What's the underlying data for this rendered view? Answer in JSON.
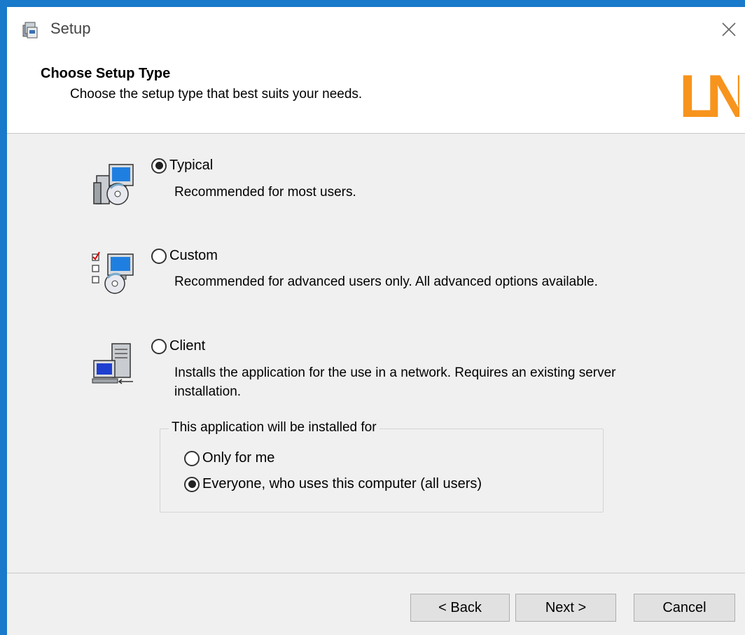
{
  "window": {
    "title": "Setup",
    "close_icon": "close-icon",
    "app_icon": "setup-app-icon"
  },
  "header": {
    "title": "Choose Setup Type",
    "subtitle": "Choose the setup type that best suits your needs.",
    "logo_text": "LN",
    "logo_color": "#f7941d"
  },
  "options": [
    {
      "label": "Typical",
      "description": "Recommended for most users.",
      "selected": true,
      "icon": "typical-setup-icon"
    },
    {
      "label": "Custom",
      "description": "Recommended for advanced users only. All advanced options available.",
      "selected": false,
      "icon": "custom-setup-icon"
    },
    {
      "label": "Client",
      "description": "Installs the application for the use in a network. Requires an existing server installation.",
      "selected": false,
      "icon": "client-setup-icon"
    }
  ],
  "install_for": {
    "legend": "This application will be installed for",
    "options": [
      {
        "label": "Only for me",
        "selected": false
      },
      {
        "label": "Everyone, who uses this computer (all users)",
        "selected": true
      }
    ]
  },
  "buttons": {
    "back": "< Back",
    "next": "Next >",
    "cancel": "Cancel"
  },
  "colors": {
    "title_border": "#1979ca",
    "dialog_bg": "#f0f0f0"
  }
}
